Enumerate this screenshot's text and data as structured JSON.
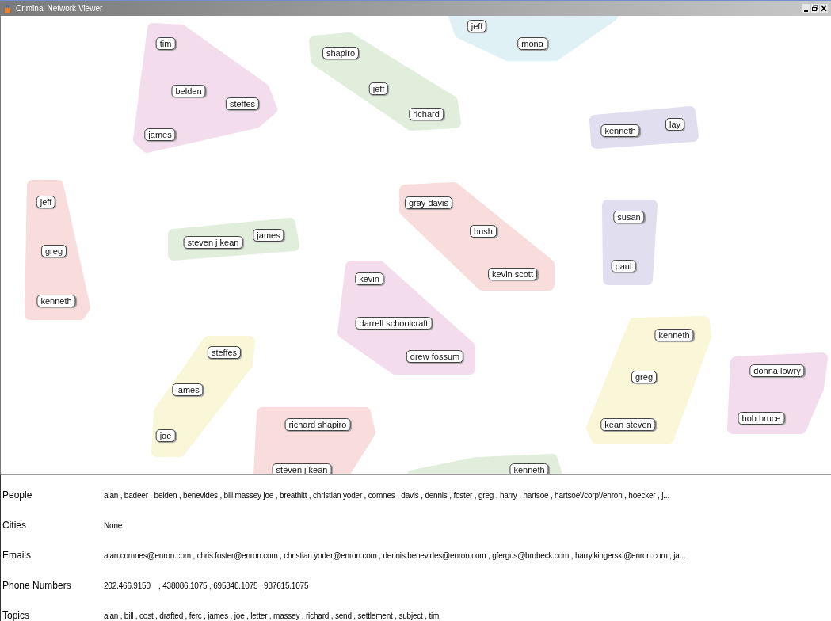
{
  "window": {
    "title": "Criminal Network Viewer"
  },
  "clusters": [
    {
      "color": "#dff1f5",
      "nodes": [
        "jeff",
        "mona"
      ]
    },
    {
      "color": "#f3dcec",
      "nodes": [
        "tim",
        "belden",
        "steffes",
        "james"
      ]
    },
    {
      "color": "#e1eedb",
      "nodes": [
        "shapiro",
        "jeff",
        "richard"
      ]
    },
    {
      "color": "#e1def0",
      "nodes": [
        "kenneth",
        "lay"
      ]
    },
    {
      "color": "#f9dcdc",
      "nodes": [
        "jeff",
        "greg",
        "kenneth"
      ]
    },
    {
      "color": "#e1eedb",
      "nodes": [
        "steven j kean",
        "james"
      ]
    },
    {
      "color": "#f9dcdc",
      "nodes": [
        "gray davis",
        "bush",
        "kevin scott"
      ]
    },
    {
      "color": "#e1def0",
      "nodes": [
        "susan",
        "paul"
      ]
    },
    {
      "color": "#f3dcec",
      "nodes": [
        "kevin",
        "darrell schoolcraft",
        "drew fossum"
      ]
    },
    {
      "color": "#f9f7d7",
      "nodes": [
        "steffes",
        "james",
        "joe"
      ]
    },
    {
      "color": "#f9f7d7",
      "nodes": [
        "kenneth",
        "greg",
        "kean steven"
      ]
    },
    {
      "color": "#f3dcec",
      "nodes": [
        "donna lowry",
        "bob bruce"
      ]
    },
    {
      "color": "#f9dcdc",
      "nodes": [
        "richard shapiro",
        "steven j kean"
      ]
    },
    {
      "color": "#e1eedb",
      "nodes": [
        "kenneth"
      ]
    }
  ],
  "details": [
    {
      "label": "People",
      "value": "alan , badeer , belden , benevides , bill massey joe , breathitt , christian yoder , comnes , davis , dennis , foster , greg , harry , hartsoe , hartsoe\\/corp\\/enron , hoecker , j..."
    },
    {
      "label": "Cities",
      "value": "None"
    },
    {
      "label": "Emails",
      "value": "alan.comnes@enron.com , chris.foster@enron.com , christian.yoder@enron.com , dennis.benevides@enron.com , gfergus@brobeck.com , harry.kingerski@enron.com , ja..."
    },
    {
      "label": "Phone Numbers",
      "value": "202.466.9150    , 438086.1075 , 695348.1075 , 987615.1075"
    },
    {
      "label": "Topics",
      "value": "alan , bill , cost , drafted , ferc , james , joe , letter , massey , richard , send , settlement , subject , tim"
    }
  ]
}
